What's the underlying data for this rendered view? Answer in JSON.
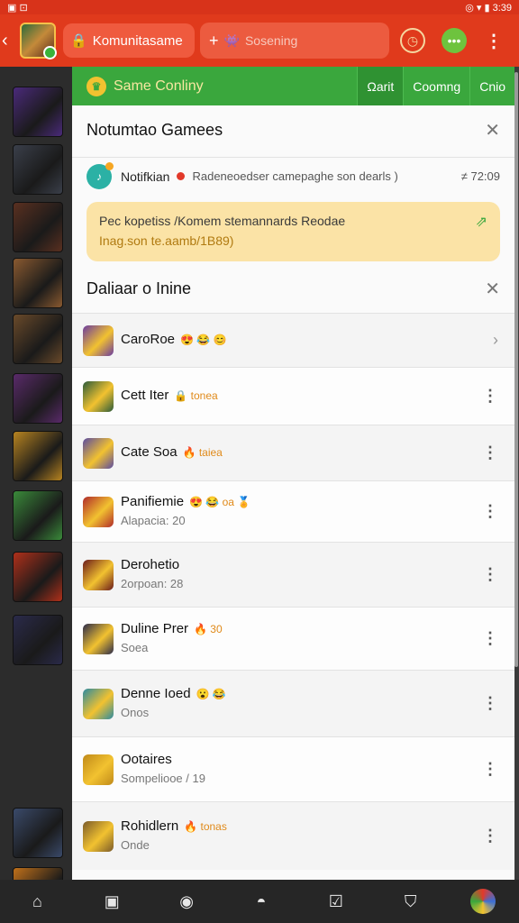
{
  "status": {
    "left": "▣ ⊡",
    "right": "◎ ▾ ▮ 3:39"
  },
  "topbar": {
    "back": "‹",
    "lock_icon": "lock-icon",
    "search_label": "Komunitasame",
    "add_label": "Sosening",
    "clock_icon": "clock-icon",
    "chat_icon": "chat-icon",
    "more_icon": "more-icon"
  },
  "panel": {
    "green_title": "Same Conliny",
    "tabs": [
      "Ωarit",
      "Coomng",
      "Cnio"
    ],
    "section1_title": "Notumtao Gamees",
    "notification": {
      "title": "Notifkian",
      "message": "Radeneoedser camepaghe son dearls )",
      "time": "≠ 72:09"
    },
    "promo": {
      "line1": "Pec kopetiss /Komem stemannards Reodae",
      "line2": "Inag.son te.aamb/1B89)"
    },
    "section2_title": "Daliaar o Inine",
    "rows": [
      {
        "name": "CaroRoe",
        "badge": "😍 😂 😊",
        "sub": "",
        "end": "›"
      },
      {
        "name": "Cett Iter",
        "badge": "🔒 tonea",
        "sub": "",
        "end": "⋮"
      },
      {
        "name": "Cate Soa",
        "badge": "🔥 taiea",
        "sub": "",
        "end": "⋮"
      },
      {
        "name": "Panifiemie",
        "badge": "😍 😂 oa 🏅",
        "sub": "Alapacia: 20",
        "end": "⋮"
      },
      {
        "name": "Derohetio",
        "badge": "",
        "sub": "2orpoan: 28",
        "end": "⋮"
      },
      {
        "name": "Duline Prer",
        "badge": "🔥 30",
        "sub": "Soea",
        "end": "⋮"
      },
      {
        "name": "Denne Ioed",
        "badge": "😮 😂",
        "sub": "Onos",
        "end": "⋮"
      },
      {
        "name": "Ootaires",
        "badge": "",
        "sub": "Sompeliooe / 19",
        "end": "⋮"
      },
      {
        "name": "Rohidlern",
        "badge": "🔥 tonas",
        "sub": "Onde",
        "end": "⋮"
      }
    ]
  },
  "rail_colors": [
    "#4a2a7a",
    "#3a3f4a",
    "#5a3020",
    "#8a5a30",
    "#6a4a2a",
    "#5a2a6a",
    "#b88420",
    "#3a8a3a",
    "#b0301a",
    "#2a2a4a",
    "#3a4a6a",
    "#c0701a"
  ],
  "bottom_nav": [
    "home-icon",
    "library-icon",
    "gamepad-icon",
    "controller-icon",
    "checklist-icon",
    "shield-icon",
    "avatar"
  ]
}
